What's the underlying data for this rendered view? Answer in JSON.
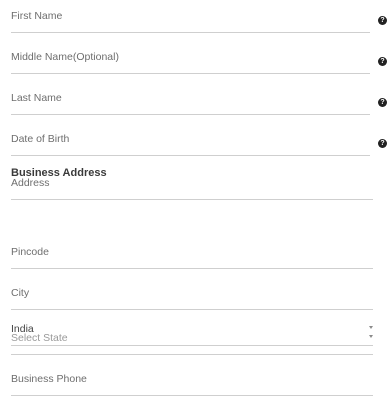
{
  "personal": {
    "first_name_label": "First Name",
    "middle_name_label": "Middle Name(Optional)",
    "last_name_label": "Last Name",
    "dob_label": "Date of Birth",
    "help_glyph": "?"
  },
  "business": {
    "section_title": "Business Address",
    "address_label": "Address",
    "pincode_label": "Pincode",
    "city_label": "City",
    "country_value": "India",
    "state_placeholder": "Select State",
    "phone_label": "Business Phone"
  },
  "icons": {
    "help": "question-circle-icon",
    "dropdown": "chevron-down-icon"
  },
  "colors": {
    "underline": "#cfcfcf",
    "label": "#6e6e6e",
    "help_icon": "#222222"
  }
}
